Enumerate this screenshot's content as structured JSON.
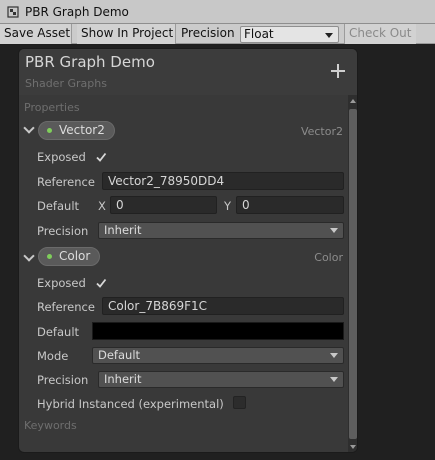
{
  "window": {
    "title": "PBR Graph Demo"
  },
  "toolbar": {
    "save_label": "Save Asset",
    "show_label": "Show In Project",
    "precision_label": "Precision",
    "precision_value": "Float",
    "checkout_label": "Check Out"
  },
  "blackboard": {
    "title": "PBR Graph Demo",
    "subtitle": "Shader Graphs",
    "add_icon": "plus-icon",
    "properties_title": "Properties",
    "keywords_title": "Keywords",
    "properties": [
      {
        "name": "Vector2",
        "type": "Vector2",
        "exposed_label": "Exposed",
        "exposed": true,
        "reference_label": "Reference",
        "reference": "Vector2_78950DD4",
        "default_label": "Default",
        "x_label": "X",
        "x_value": "0",
        "y_label": "Y",
        "y_value": "0",
        "precision_label": "Precision",
        "precision_value": "Inherit"
      },
      {
        "name": "Color",
        "type": "Color",
        "exposed_label": "Exposed",
        "exposed": true,
        "reference_label": "Reference",
        "reference": "Color_7B869F1C",
        "default_label": "Default",
        "default_color": "#000000",
        "mode_label": "Mode",
        "mode_value": "Default",
        "precision_label": "Precision",
        "precision_value": "Inherit",
        "hybrid_label": "Hybrid Instanced (experimental)",
        "hybrid": false
      }
    ]
  },
  "colors": {
    "dot": "#7fce5b",
    "panel": "#393939",
    "background": "#202020"
  }
}
